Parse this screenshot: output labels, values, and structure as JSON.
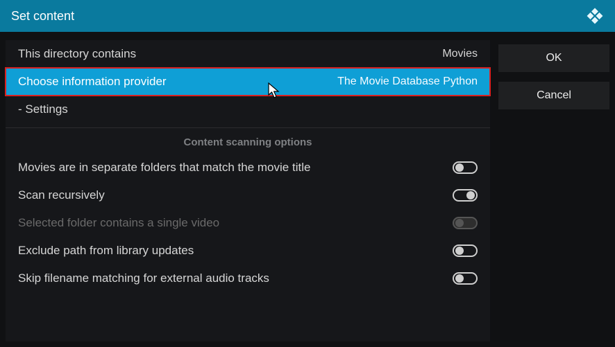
{
  "titlebar": {
    "title": "Set content"
  },
  "settings": {
    "directory_contains": {
      "label": "This directory contains",
      "value": "Movies"
    },
    "info_provider": {
      "label": "Choose information provider",
      "value": "The Movie Database Python"
    },
    "settings_item": {
      "label": "- Settings"
    },
    "section_header": "Content scanning options",
    "opts": {
      "separate_folders": {
        "label": "Movies are in separate folders that match the movie title",
        "on": false
      },
      "scan_recursively": {
        "label": "Scan recursively",
        "on": true
      },
      "single_video": {
        "label": "Selected folder contains a single video",
        "on": false,
        "disabled": true
      },
      "exclude_library": {
        "label": "Exclude path from library updates",
        "on": false
      },
      "skip_filename_match": {
        "label": "Skip filename matching for external audio tracks",
        "on": false
      }
    }
  },
  "buttons": {
    "ok": "OK",
    "cancel": "Cancel"
  }
}
